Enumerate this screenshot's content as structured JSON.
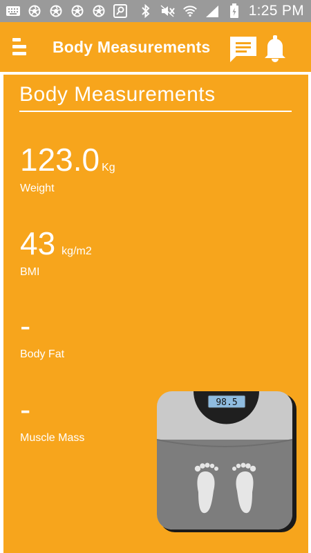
{
  "status_bar": {
    "time": "1:25 PM",
    "left_icons": [
      "keyboard-icon",
      "aperture-icon",
      "aperture-icon",
      "aperture-icon",
      "aperture-icon",
      "search-app-icon"
    ],
    "right_icons": [
      "bluetooth-icon",
      "mute-icon",
      "wifi-icon",
      "signal-icon",
      "battery-charging-icon"
    ]
  },
  "app_bar": {
    "title": "Body Measurements",
    "menu_icon": "menu-icon",
    "chat_icon": "chat-icon",
    "bell_icon": "bell-icon"
  },
  "card": {
    "title": "Body Measurements",
    "metrics": [
      {
        "value": "123.0",
        "unit": "Kg",
        "label": "Weight"
      },
      {
        "value": "43",
        "unit": "kg/m2",
        "label": "BMI"
      },
      {
        "value": "-",
        "unit": "",
        "label": "Body Fat"
      },
      {
        "value": "-",
        "unit": "",
        "label": "Muscle Mass"
      }
    ],
    "scale_display": "98.5"
  },
  "colors": {
    "accent": "#f7a51c",
    "status_bar": "#9a9a9a",
    "text": "#ffffff",
    "scale_body": "#c9c9c9",
    "scale_platform": "#7d7d7d",
    "scale_display": "#8fbce0"
  }
}
